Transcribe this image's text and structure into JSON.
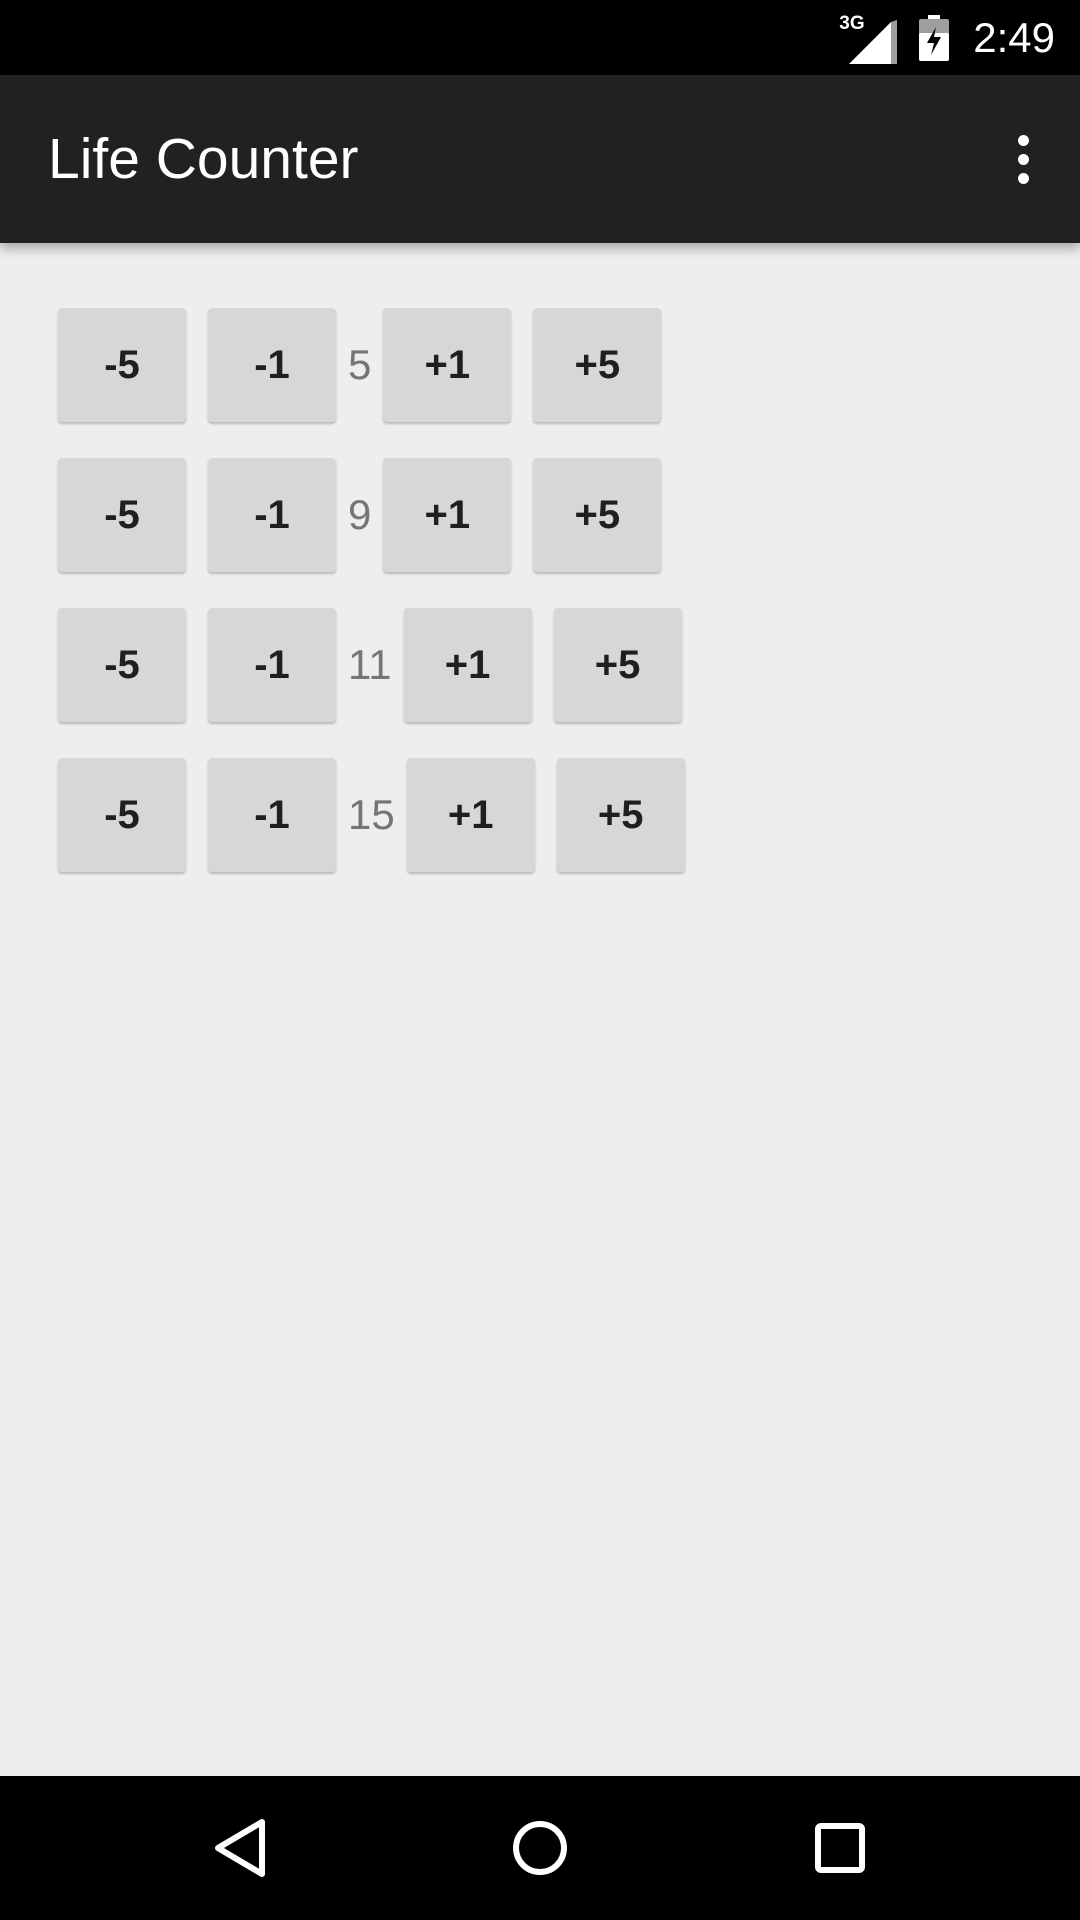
{
  "status_bar": {
    "network_type": "3G",
    "time": "2:49"
  },
  "app_bar": {
    "title": "Life Counter"
  },
  "counters": [
    {
      "minus5": "-5",
      "minus1": "-1",
      "value": "5",
      "plus1": "+1",
      "plus5": "+5"
    },
    {
      "minus5": "-5",
      "minus1": "-1",
      "value": "9",
      "plus1": "+1",
      "plus5": "+5"
    },
    {
      "minus5": "-5",
      "minus1": "-1",
      "value": "11",
      "plus1": "+1",
      "plus5": "+5"
    },
    {
      "minus5": "-5",
      "minus1": "-1",
      "value": "15",
      "plus1": "+1",
      "plus5": "+5"
    }
  ],
  "icons": {
    "signal": "signal-icon",
    "battery": "battery-charging-icon",
    "overflow": "overflow-menu-icon",
    "back": "back-icon",
    "home": "home-icon",
    "recents": "recents-icon"
  },
  "colors": {
    "app_bar": "#212121",
    "background": "#eeeeee",
    "button": "#d6d7d7",
    "value_text": "#757575"
  }
}
